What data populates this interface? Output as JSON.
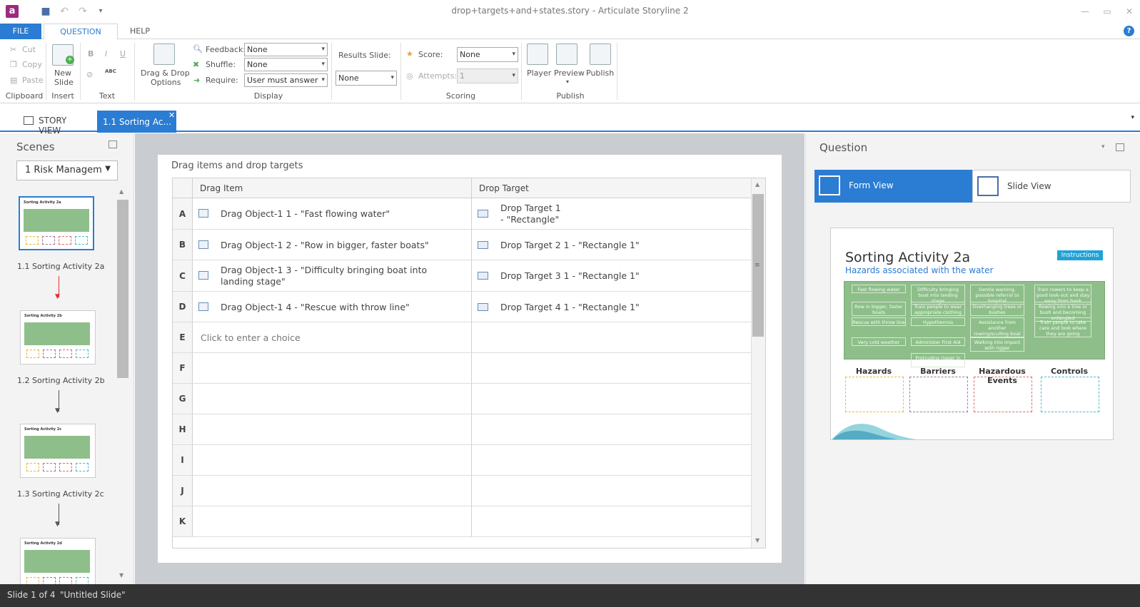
{
  "window": {
    "title": "drop+targets+and+states.story -  Articulate Storyline 2",
    "logo_letter": "a"
  },
  "ribbon_tabs": {
    "file": "FILE",
    "question": "QUESTION",
    "help": "HELP"
  },
  "ribbon": {
    "clipboard": {
      "cut": "Cut",
      "copy": "Copy",
      "paste": "Paste",
      "group": "Clipboard"
    },
    "insert": {
      "new_slide_1": "New",
      "new_slide_2": "Slide",
      "group": "Insert"
    },
    "text": {
      "bold": "B",
      "italic": "I",
      "underline": "U",
      "spell": "ABC",
      "group": "Text"
    },
    "display": {
      "dd_options_1": "Drag & Drop",
      "dd_options_2": "Options",
      "feedback_label": "Feedback:",
      "feedback_value": "None",
      "shuffle_label": "Shuffle:",
      "shuffle_value": "None",
      "require_label": "Require:",
      "require_value": "User must answer",
      "group": "Display"
    },
    "results": {
      "label": "Results Slide:",
      "value": "None"
    },
    "scoring": {
      "score_label": "Score:",
      "score_value": "None",
      "attempts_label": "Attempts:",
      "attempts_value": "1",
      "group": "Scoring"
    },
    "publish": {
      "player": "Player",
      "preview": "Preview",
      "publish": "Publish",
      "group": "Publish"
    }
  },
  "doc_tabs": {
    "story_view": "STORY VIEW",
    "slide_tab": "1.1 Sorting Ac..."
  },
  "scenes": {
    "title": "Scenes",
    "selected_scene": "1 Risk Managem",
    "thumbnails": [
      {
        "label": "1.1 Sorting Activity 2a",
        "head": "Sorting Activity 2a"
      },
      {
        "label": "1.2 Sorting Activity 2b",
        "head": "Sorting Activity 2b"
      },
      {
        "label": "1.3 Sorting Activity 2c",
        "head": "Sorting Activity 2c"
      },
      {
        "label": "",
        "head": "Sorting Activity 2d"
      }
    ]
  },
  "drag_drop": {
    "title": "Drag items and drop targets",
    "col_drag": "Drag Item",
    "col_drop": "Drop Target",
    "rows": [
      {
        "letter": "A",
        "drag": "Drag Object-1 1 - \"Fast flowing water\"",
        "drop": "Drop Target 1\n - \"Rectangle\""
      },
      {
        "letter": "B",
        "drag": "Drag Object-1 2 - \"Row in bigger, faster boats\"",
        "drop": "Drop Target 2 1 - \"Rectangle 1\""
      },
      {
        "letter": "C",
        "drag": "Drag Object-1 3 - \"Difficulty bringing boat into landing stage\"",
        "drop": "Drop Target 3 1 - \"Rectangle 1\""
      },
      {
        "letter": "D",
        "drag": "Drag Object-1 4 - \"Rescue with throw line\"",
        "drop": "Drop Target 4 1 - \"Rectangle 1\""
      },
      {
        "letter": "E",
        "drag": "Click to enter a choice",
        "drop": ""
      },
      {
        "letter": "F",
        "drag": "",
        "drop": ""
      },
      {
        "letter": "G",
        "drag": "",
        "drop": ""
      },
      {
        "letter": "H",
        "drag": "",
        "drop": ""
      },
      {
        "letter": "I",
        "drag": "",
        "drop": ""
      },
      {
        "letter": "J",
        "drag": "",
        "drop": ""
      },
      {
        "letter": "K",
        "drag": "",
        "drop": ""
      }
    ]
  },
  "question_panel": {
    "title": "Question",
    "form_view": "Form View",
    "slide_view": "Slide View",
    "preview": {
      "title": "Sorting Activity 2a",
      "subtitle": "Hazards associated with the water",
      "instructions": "Instructions",
      "chips": [
        [
          "Fast flowing water",
          "Difficulty bringing boat into landing stage",
          "Gentle warning, possible referral to hospital",
          "Train rowers to keep a good look-out and stay away from bank"
        ],
        [
          "Row in bigger, faster boats",
          "Train people to wear appropriate clothing",
          "Overhanging trees or bushes",
          "Rowing into a tree or bush and becoming entangled"
        ],
        [
          "Rescue with throw line",
          "Hypothermia",
          "Assistance from another rowing/sculling boat",
          "Train people to take care and look where they are going"
        ],
        [
          "Very cold weather",
          "Administer First Aid",
          "Walking into impact with rigger",
          ""
        ],
        [
          "",
          "Protruding rigger in boat house",
          "",
          ""
        ]
      ],
      "categories": [
        "Hazards",
        "Barriers",
        "Hazardous Events",
        "Controls"
      ],
      "category_colors": [
        "#e8b83a",
        "#9b7a9b",
        "#d96b6b",
        "#4fb7c9"
      ]
    }
  },
  "status": {
    "slide": "Slide 1 of 4",
    "name": "\"Untitled Slide\""
  },
  "colors": {
    "accent": "#2b7cd3",
    "green": "#8ebf8a",
    "status_bg": "#333333"
  }
}
